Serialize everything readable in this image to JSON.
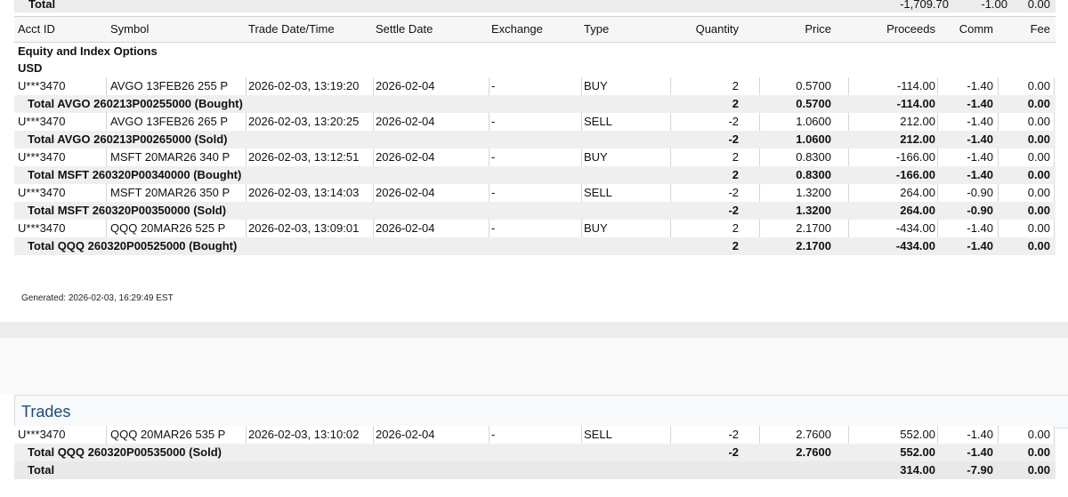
{
  "top_total": {
    "label": "Total",
    "proceeds": "-1,709.70",
    "comm": "-1.00",
    "fee": "0.00"
  },
  "columns": {
    "acct_id": "Acct ID",
    "symbol": "Symbol",
    "trade_dt": "Trade Date/Time",
    "settle": "Settle Date",
    "exchange": "Exchange",
    "type": "Type",
    "quantity": "Quantity",
    "price": "Price",
    "proceeds": "Proceeds",
    "comm": "Comm",
    "fee": "Fee"
  },
  "section": {
    "category": "Equity and Index Options",
    "currency": "USD"
  },
  "rows": [
    {
      "kind": "detail",
      "acct": "U***3470",
      "symbol": "AVGO 13FEB26 255 P",
      "trade_dt": "2026-02-03, 13:19:20",
      "settle": "2026-02-04",
      "exchange": "-",
      "type": "BUY",
      "qty": "2",
      "price": "0.5700",
      "proceeds": "-114.00",
      "comm": "-1.40",
      "fee": "0.00"
    },
    {
      "kind": "sub",
      "label": "Total AVGO  260213P00255000 (Bought)",
      "qty": "2",
      "price": "0.5700",
      "proceeds": "-114.00",
      "comm": "-1.40",
      "fee": "0.00"
    },
    {
      "kind": "detail",
      "acct": "U***3470",
      "symbol": "AVGO 13FEB26 265 P",
      "trade_dt": "2026-02-03, 13:20:25",
      "settle": "2026-02-04",
      "exchange": "-",
      "type": "SELL",
      "qty": "-2",
      "price": "1.0600",
      "proceeds": "212.00",
      "comm": "-1.40",
      "fee": "0.00"
    },
    {
      "kind": "sub",
      "label": "Total AVGO  260213P00265000 (Sold)",
      "qty": "-2",
      "price": "1.0600",
      "proceeds": "212.00",
      "comm": "-1.40",
      "fee": "0.00"
    },
    {
      "kind": "detail",
      "acct": "U***3470",
      "symbol": "MSFT 20MAR26 340 P",
      "trade_dt": "2026-02-03, 13:12:51",
      "settle": "2026-02-04",
      "exchange": "-",
      "type": "BUY",
      "qty": "2",
      "price": "0.8300",
      "proceeds": "-166.00",
      "comm": "-1.40",
      "fee": "0.00"
    },
    {
      "kind": "sub",
      "label": "Total MSFT  260320P00340000 (Bought)",
      "qty": "2",
      "price": "0.8300",
      "proceeds": "-166.00",
      "comm": "-1.40",
      "fee": "0.00"
    },
    {
      "kind": "detail",
      "acct": "U***3470",
      "symbol": "MSFT 20MAR26 350 P",
      "trade_dt": "2026-02-03, 13:14:03",
      "settle": "2026-02-04",
      "exchange": "-",
      "type": "SELL",
      "qty": "-2",
      "price": "1.3200",
      "proceeds": "264.00",
      "comm": "-0.90",
      "fee": "0.00"
    },
    {
      "kind": "sub",
      "label": "Total MSFT  260320P00350000 (Sold)",
      "qty": "-2",
      "price": "1.3200",
      "proceeds": "264.00",
      "comm": "-0.90",
      "fee": "0.00"
    },
    {
      "kind": "detail",
      "acct": "U***3470",
      "symbol": "QQQ 20MAR26 525 P",
      "trade_dt": "2026-02-03, 13:09:01",
      "settle": "2026-02-04",
      "exchange": "-",
      "type": "BUY",
      "qty": "2",
      "price": "2.1700",
      "proceeds": "-434.00",
      "comm": "-1.40",
      "fee": "0.00"
    },
    {
      "kind": "sub",
      "label": "Total QQQ  260320P00525000 (Bought)",
      "qty": "2",
      "price": "2.1700",
      "proceeds": "-434.00",
      "comm": "-1.40",
      "fee": "0.00"
    }
  ],
  "generated": "Generated: 2026-02-03, 16:29:49 EST",
  "trades": {
    "title": "Trades",
    "rows": [
      {
        "kind": "detail",
        "acct": "U***3470",
        "symbol": "QQQ 20MAR26 535 P",
        "trade_dt": "2026-02-03, 13:10:02",
        "settle": "2026-02-04",
        "exchange": "-",
        "type": "SELL",
        "qty": "-2",
        "price": "2.7600",
        "proceeds": "552.00",
        "comm": "-1.40",
        "fee": "0.00"
      },
      {
        "kind": "sub",
        "label": "Total QQQ  260320P00535000 (Sold)",
        "qty": "-2",
        "price": "2.7600",
        "proceeds": "552.00",
        "comm": "-1.40",
        "fee": "0.00"
      }
    ],
    "total": {
      "label": "Total",
      "proceeds": "314.00",
      "comm": "-7.90",
      "fee": "0.00"
    }
  }
}
